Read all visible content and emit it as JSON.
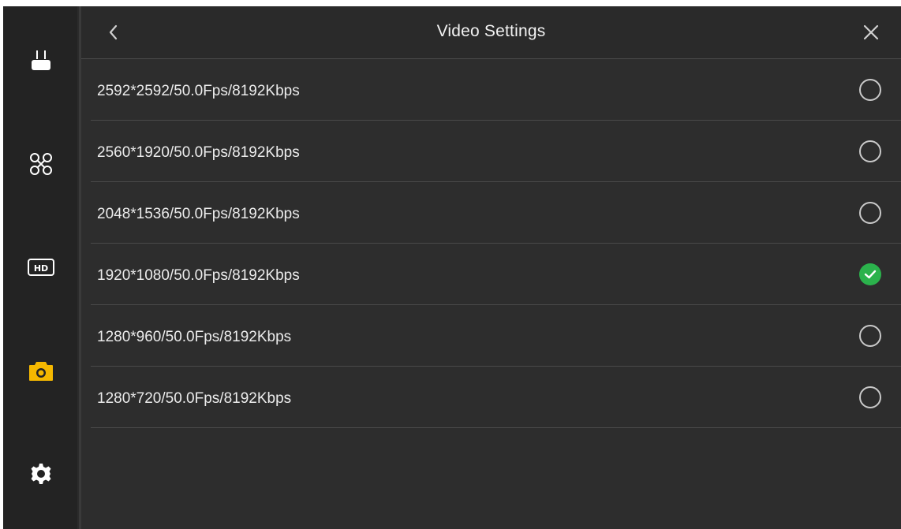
{
  "header": {
    "title": "Video Settings",
    "back_icon": "chevron-left-icon",
    "close_icon": "close-icon"
  },
  "sidebar": {
    "items": [
      {
        "icon": "remote-controller-icon",
        "active": false
      },
      {
        "icon": "drone-icon",
        "active": false
      },
      {
        "icon": "hd-icon",
        "active": false
      },
      {
        "icon": "camera-icon",
        "active": true
      },
      {
        "icon": "gear-icon",
        "active": false
      }
    ]
  },
  "options": [
    {
      "label": "2592*2592/50.0Fps/8192Kbps",
      "selected": false
    },
    {
      "label": "2560*1920/50.0Fps/8192Kbps",
      "selected": false
    },
    {
      "label": "2048*1536/50.0Fps/8192Kbps",
      "selected": false
    },
    {
      "label": "1920*1080/50.0Fps/8192Kbps",
      "selected": true
    },
    {
      "label": "1280*960/50.0Fps/8192Kbps",
      "selected": false
    },
    {
      "label": "1280*720/50.0Fps/8192Kbps",
      "selected": false
    }
  ],
  "colors": {
    "accent_active": "#f5b800",
    "selected_check": "#2bb24c",
    "background": "#2d2d2d",
    "sidebar": "#232323"
  }
}
